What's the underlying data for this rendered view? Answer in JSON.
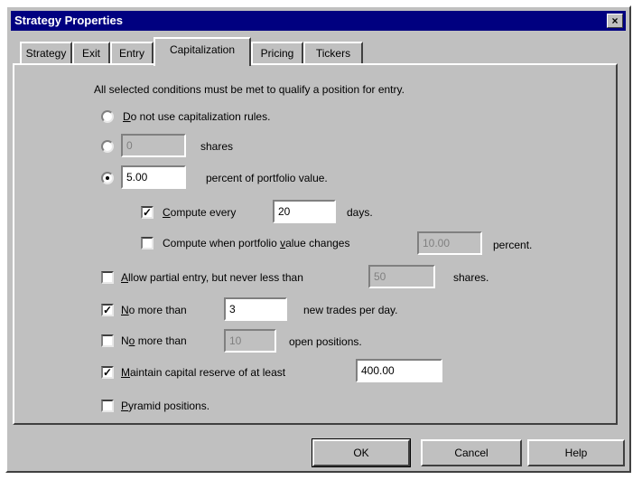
{
  "window": {
    "title": "Strategy Properties",
    "close_glyph": "×"
  },
  "tabs": [
    {
      "label": "Strategy"
    },
    {
      "label": "Exit"
    },
    {
      "label": "Entry"
    },
    {
      "label": "Capitalization"
    },
    {
      "label": "Pricing"
    },
    {
      "label": "Tickers"
    }
  ],
  "active_tab": "Capitalization",
  "content": {
    "intro": "All selected conditions must be met to qualify a position for entry.",
    "no_rules": {
      "label_u": "D",
      "label_rest": "o not use capitalization rules.",
      "selected": false
    },
    "shares_option": {
      "value": "0",
      "suffix": "shares",
      "selected": false
    },
    "percent_option": {
      "value": "5.00",
      "suffix": "percent of portfolio value.",
      "selected": true
    },
    "compute_every": {
      "label_u": "C",
      "label_rest": "ompute every",
      "value": "20",
      "suffix": "days.",
      "checked": true
    },
    "compute_when": {
      "label_pre": "Compute when portfolio ",
      "label_u": "v",
      "label_rest": "alue changes",
      "value": "10.00",
      "suffix": "percent.",
      "checked": false
    },
    "partial_entry": {
      "label_u": "A",
      "label_rest": "llow partial entry, but never less than",
      "value": "50",
      "suffix": "shares.",
      "checked": false
    },
    "max_trades": {
      "label_u": "N",
      "label_rest": "o more than",
      "value": "3",
      "suffix": "new trades per day.",
      "checked": true
    },
    "max_positions": {
      "label_pre": "N",
      "label_u": "o",
      "label_rest": " more than",
      "value": "10",
      "suffix": "open positions.",
      "checked": false
    },
    "capital_reserve": {
      "label_u": "M",
      "label_rest": "aintain capital reserve of at least",
      "value": "400.00",
      "checked": true
    },
    "pyramid": {
      "label_u": "P",
      "label_rest": "yramid positions.",
      "checked": false
    }
  },
  "buttons": {
    "ok": "OK",
    "cancel": "Cancel",
    "help": "Help"
  },
  "check_glyph": "✓"
}
